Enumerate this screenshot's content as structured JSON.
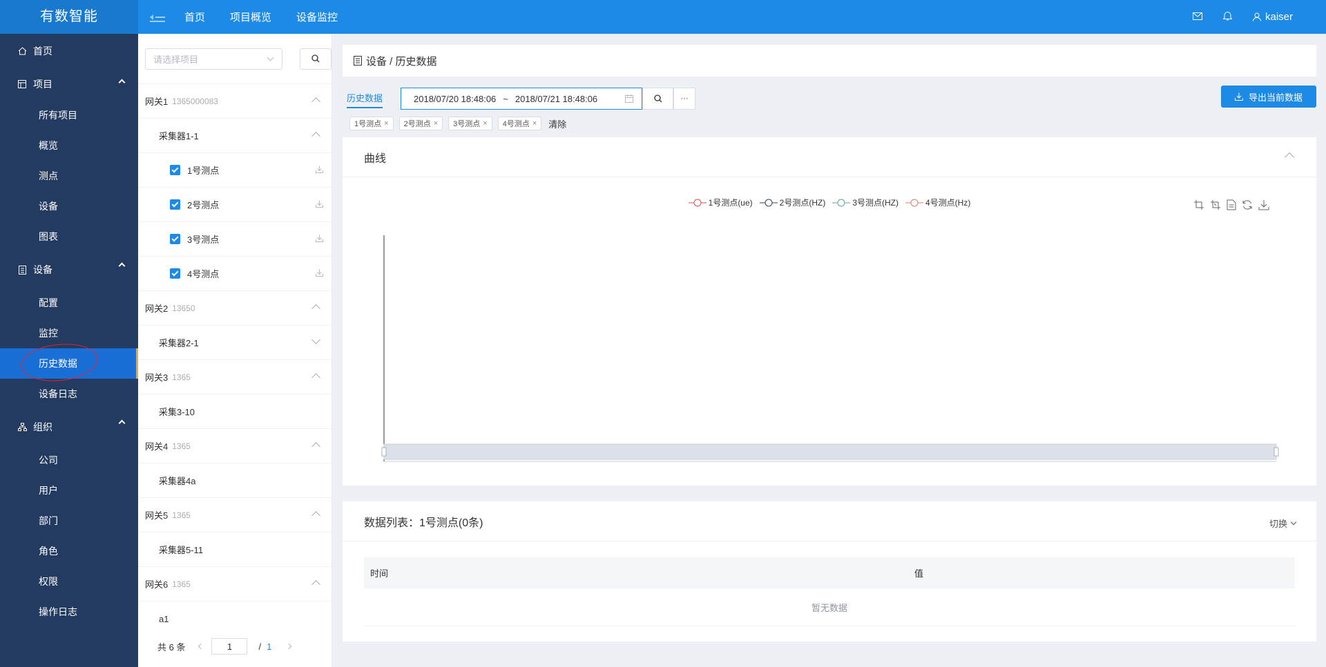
{
  "app": {
    "brand": "有数智能"
  },
  "topnav": [
    "首页",
    "项目概览",
    "设备监控"
  ],
  "user": {
    "name": "kaiser"
  },
  "sidebar": {
    "home": "首页",
    "project": {
      "label": "项目",
      "items": [
        "所有项目",
        "概览",
        "测点",
        "设备",
        "图表"
      ]
    },
    "device": {
      "label": "设备",
      "items": [
        "配置",
        "监控",
        "历史数据",
        "设备日志"
      ]
    },
    "org": {
      "label": "组织",
      "items": [
        "公司",
        "用户",
        "部门",
        "角色",
        "权限",
        "操作日志"
      ]
    },
    "active_item": "历史数据"
  },
  "tree": {
    "search_placeholder": "请选择项目",
    "gateways": [
      {
        "name": "网关1",
        "id": "1365000083",
        "expanded": true
      },
      {
        "name": "网关2",
        "id": "13650",
        "expanded": true
      },
      {
        "name": "网关3",
        "id": "1365",
        "expanded": true
      },
      {
        "name": "网关4",
        "id": "1365",
        "expanded": true
      },
      {
        "name": "网关5",
        "id": "1365",
        "expanded": true
      },
      {
        "name": "网关6",
        "id": "1365",
        "expanded": true
      }
    ],
    "collectors": [
      "采集器1-1",
      "采集器2-1",
      "采集3-10",
      "采集器4a",
      "采集器5-11",
      "a1"
    ],
    "points": [
      "1号测点",
      "2号测点",
      "3号测点",
      "4号测点"
    ],
    "pager": {
      "total_label": "共 6 条",
      "page": "1",
      "slash": "/",
      "total_pages": "1"
    }
  },
  "breadcrumb": "设备 / 历史数据",
  "toolbar": {
    "tab": "历史数据",
    "date_start": "2018/07/20 18:48:06",
    "date_sep": "~",
    "date_end": "2018/07/21 18:48:06",
    "more": "···",
    "export": "导出当前数据"
  },
  "tags": [
    "1号测点",
    "2号测点",
    "3号测点",
    "4号测点"
  ],
  "tags_clear": "清除",
  "chart_panel": {
    "title": "曲线",
    "legend": [
      {
        "name": "1号测点(ue)",
        "color": "#d94e4e"
      },
      {
        "name": "2号测点(HZ)",
        "color": "#2f4554"
      },
      {
        "name": "3号测点(HZ)",
        "color": "#61a0a8"
      },
      {
        "name": "4号测点(Hz)",
        "color": "#d48265"
      }
    ]
  },
  "chart_data": {
    "type": "line",
    "series": [
      {
        "name": "1号测点(ue)",
        "values": []
      },
      {
        "name": "2号测点(HZ)",
        "values": []
      },
      {
        "name": "3号测点(HZ)",
        "values": []
      },
      {
        "name": "4号测点(Hz)",
        "values": []
      }
    ],
    "legend_position": "top-center",
    "datazoom": true
  },
  "table_panel": {
    "title": "数据列表：1号测点(0条)",
    "switch": "切换",
    "columns": [
      "时间",
      "值"
    ],
    "empty": "暂无数据"
  },
  "colors": {
    "accent": "#1d8ae6",
    "sidebar_bg": "#233a61",
    "active_bg": "#1a6fd6"
  }
}
